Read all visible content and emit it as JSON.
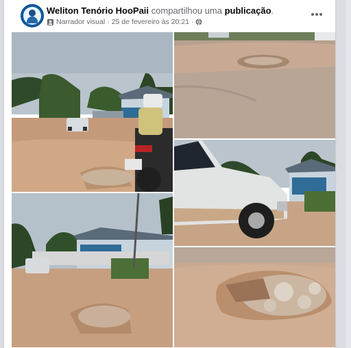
{
  "post": {
    "author": "Weliton Tenório HooPaii",
    "action": "compartilhou uma",
    "object": "publicação",
    "period": ".",
    "narrator_label": "Narrador visual",
    "separator": "·",
    "date": "25 de fevereiro às 20:21",
    "privacy_icon": "globe-icon",
    "narrator_icon": "narrator-icon",
    "more_icon": "more-options-icon"
  },
  "photos": [
    {
      "name": "photo-street-car-motorcycle"
    },
    {
      "name": "photo-road-pothole-top"
    },
    {
      "name": "photo-white-pickup-truck"
    },
    {
      "name": "photo-blue-house-street"
    },
    {
      "name": "photo-pothole-closeup"
    }
  ],
  "colors": {
    "author": "#050505",
    "secondary_text": "#65676b",
    "avatar": "#0a5aa0",
    "background": "#dadde1"
  }
}
